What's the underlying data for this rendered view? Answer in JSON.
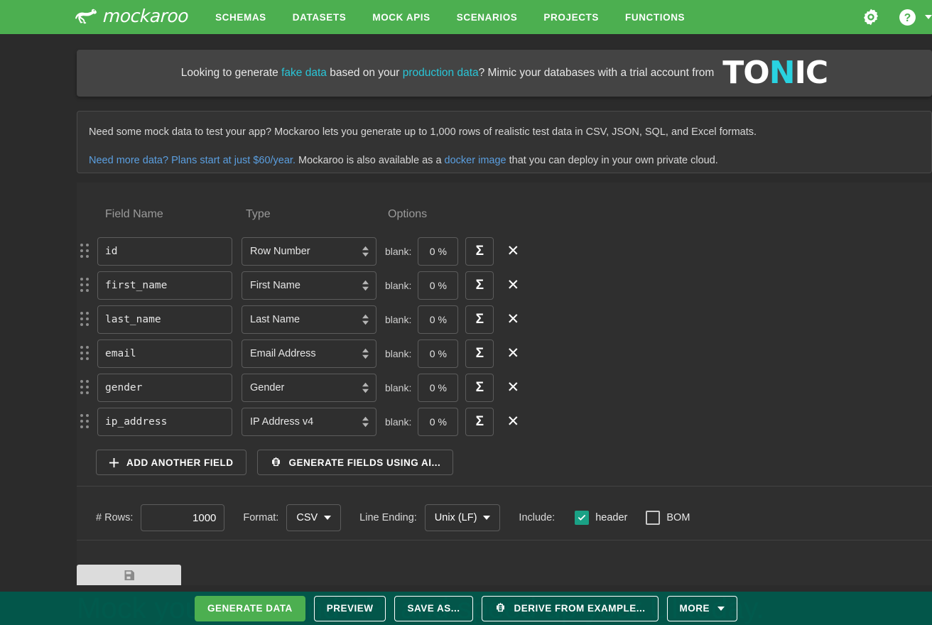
{
  "navbar": {
    "brand": "mockaroo",
    "brand_icon": "kangaroo-logo",
    "links": [
      "SCHEMAS",
      "DATASETS",
      "MOCK APIS",
      "SCENARIOS",
      "PROJECTS",
      "FUNCTIONS"
    ],
    "settings_icon": "gear-icon",
    "help_icon": "help-circle-icon",
    "account_caret": "chevron-down-icon",
    "bg_color": "#4caf50"
  },
  "tonic_banner": {
    "text_before_link1": "Looking to generate ",
    "link1": "fake data",
    "text_mid": " based on your ",
    "link2": "production data",
    "text_after": "? Mimic your databases with a trial account from",
    "logo_part1": "TO",
    "logo_part2": "N",
    "logo_part3": "IC",
    "link_color": "#29c6d8"
  },
  "info_banner": {
    "line1": "Need some mock data to test your app? Mockaroo lets you generate up to 1,000 rows of realistic test data in CSV, JSON, SQL, and Excel formats.",
    "line2_link1": "Need more data? Plans start at just $60/year.",
    "line2_mid": " Mockaroo is also available as a ",
    "line2_link2": "docker image",
    "line2_end": " that you can deploy in your own private cloud.",
    "link_color": "#5b9fe0"
  },
  "schema": {
    "headers": {
      "field_name": "Field Name",
      "type": "Type",
      "options": "Options"
    },
    "blank_label": "blank:",
    "sigma_label": "Σ",
    "remove_label": "✕",
    "drag_handle_icon": "drag-handle-icon",
    "rows": [
      {
        "name": "id",
        "type": "Row Number",
        "blank": "0 %"
      },
      {
        "name": "first_name",
        "type": "First Name",
        "blank": "0 %"
      },
      {
        "name": "last_name",
        "type": "Last Name",
        "blank": "0 %"
      },
      {
        "name": "email",
        "type": "Email Address",
        "blank": "0 %"
      },
      {
        "name": "gender",
        "type": "Gender",
        "blank": "0 %"
      },
      {
        "name": "ip_address",
        "type": "IP Address v4",
        "blank": "0 %"
      }
    ],
    "add_field_label": "ADD ANOTHER FIELD",
    "add_field_icon": "plus-icon",
    "generate_ai_label": "GENERATE FIELDS USING AI...",
    "generate_ai_icon": "robot-icon"
  },
  "options": {
    "rows_label": "# Rows:",
    "rows_value": "1000",
    "format_label": "Format:",
    "format_value": "CSV",
    "line_ending_label": "Line Ending:",
    "line_ending_value": "Unix (LF)",
    "include_label": "Include:",
    "header_label": "header",
    "header_checked": true,
    "bom_label": "BOM",
    "bom_checked": false,
    "checkbox_color": "#1aa185"
  },
  "save_strip": {
    "icon": "save-disk-icon"
  },
  "footer": {
    "background_text": "Mock your back-end API and speed up your UI today.",
    "buttons": [
      {
        "label": "GENERATE DATA",
        "style": "primary",
        "icon": null
      },
      {
        "label": "PREVIEW",
        "style": "outline",
        "icon": null
      },
      {
        "label": "SAVE AS...",
        "style": "outline",
        "icon": null
      },
      {
        "label": "DERIVE FROM EXAMPLE...",
        "style": "outline",
        "icon": "robot-icon"
      },
      {
        "label": "MORE",
        "style": "outline",
        "icon": "chevron-down-icon"
      }
    ],
    "bar_color": "#005a4d",
    "primary_color": "#4caf50"
  }
}
